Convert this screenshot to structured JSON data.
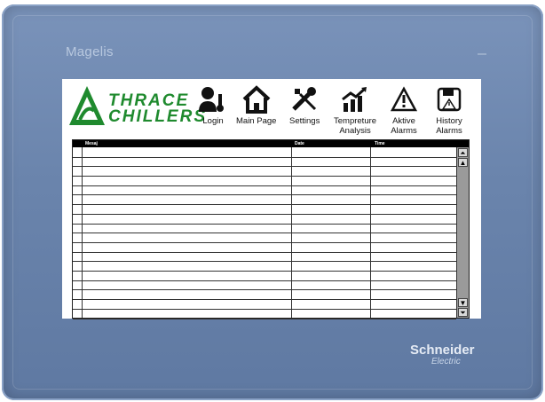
{
  "device": {
    "model": "Magelis",
    "manufacturer": "Schneider",
    "manufacturer_sub": "Electric"
  },
  "header": {
    "logo": {
      "line1": "THRACE",
      "line2": "CHILLERS"
    },
    "nav": [
      {
        "label": "Login",
        "icon": "user-key-icon"
      },
      {
        "label": "Main Page",
        "icon": "home-icon"
      },
      {
        "label": "Settings",
        "icon": "wrench-screwdriver-icon"
      },
      {
        "label": "Tempreture\nAnalysis",
        "icon": "bar-chart-trend-icon"
      },
      {
        "label": "Aktive\nAlarms",
        "icon": "warning-triangle-icon"
      },
      {
        "label": "History\nAlarms",
        "icon": "floppy-alarm-icon"
      }
    ]
  },
  "alarm_table": {
    "columns": [
      "Mesaj",
      "Date",
      "Time"
    ],
    "rows": []
  },
  "colors": {
    "bezel": "#6a84ac",
    "logo_green": "#1f8a2e",
    "header_bar": "#000000"
  }
}
